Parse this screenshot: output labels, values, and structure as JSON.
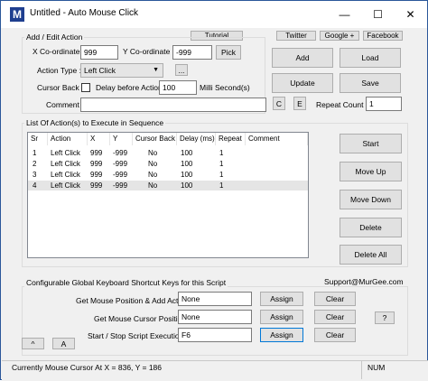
{
  "window": {
    "title": "Untitled - Auto Mouse Click",
    "app_icon_letter": "M",
    "minimize_glyph": "—",
    "maximize_glyph": "☐",
    "close_glyph": "✕"
  },
  "top_links": {
    "tutorial": "Tutorial",
    "twitter": "Twitter",
    "google": "Google +",
    "facebook": "Facebook"
  },
  "add_edit": {
    "group_label": "Add / Edit Action",
    "x_label": "X Co-ordinate :",
    "x_value": "999",
    "y_label": "Y Co-ordinate :",
    "y_value": "-999",
    "pick": "Pick",
    "action_type_label": "Action Type :",
    "action_type_value": "Left Click",
    "more_button": "...",
    "cursor_back_label": "Cursor Back :",
    "delay_label": "Delay before Action :",
    "delay_value": "100",
    "delay_unit": "Milli Second(s)",
    "comment_label": "Comment :",
    "comment_value": "",
    "c_button": "C",
    "e_button": "E",
    "repeat_label": "Repeat Count :",
    "repeat_value": "1"
  },
  "side_buttons": {
    "add": "Add",
    "load": "Load",
    "update": "Update",
    "save": "Save"
  },
  "list": {
    "group_label": "List Of Action(s) to Execute in Sequence",
    "columns": [
      "Sr",
      "Action",
      "X",
      "Y",
      "Cursor Back",
      "Delay (ms)",
      "Repeat",
      "Comment"
    ],
    "rows": [
      [
        "1",
        "Left Click",
        "999",
        "-999",
        "No",
        "100",
        "1",
        ""
      ],
      [
        "2",
        "Left Click",
        "999",
        "-999",
        "No",
        "100",
        "1",
        ""
      ],
      [
        "3",
        "Left Click",
        "999",
        "-999",
        "No",
        "100",
        "1",
        ""
      ],
      [
        "4",
        "Left Click",
        "999",
        "-999",
        "No",
        "100",
        "1",
        ""
      ]
    ]
  },
  "list_buttons": {
    "start": "Start",
    "move_up": "Move Up",
    "move_down": "Move Down",
    "delete": "Delete",
    "delete_all": "Delete All"
  },
  "shortcuts": {
    "group_label": "Configurable Global Keyboard Shortcut Keys for this Script",
    "support": "Support@MurGee.com",
    "items": [
      {
        "label": "Get Mouse Position & Add Action :",
        "value": "None",
        "assign": "Assign",
        "clear": "Clear"
      },
      {
        "label": "Get Mouse Cursor Position :",
        "value": "None",
        "assign": "Assign",
        "clear": "Clear"
      },
      {
        "label": "Start / Stop Script Execution :",
        "value": "F6",
        "assign": "Assign",
        "clear": "Clear"
      }
    ],
    "help_button": "?",
    "up_button": "^",
    "a_button": "A"
  },
  "status": {
    "cursor_text": "Currently Mouse Cursor At X = 836, Y = 186",
    "num": "NUM"
  }
}
